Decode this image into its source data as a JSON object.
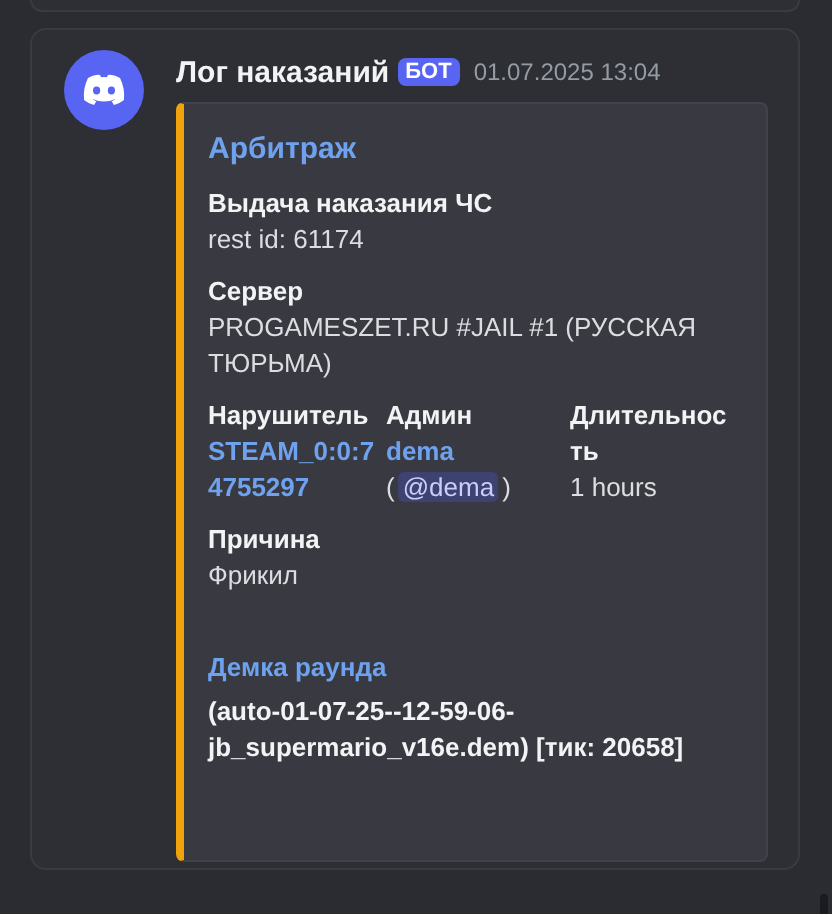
{
  "message": {
    "author": "Лог наказаний",
    "badge": "БОТ",
    "timestamp": "01.07.2025 13:04",
    "embed": {
      "color": "#f0a30a",
      "title": "Арбитраж",
      "fields": [
        {
          "kind": "plain",
          "inline": false,
          "name": "Выдача наказания ЧС",
          "value": [
            {
              "kind": "text",
              "text": "rest id: 61174"
            }
          ]
        },
        {
          "kind": "plain",
          "inline": false,
          "name": "Сервер",
          "value": [
            {
              "kind": "text",
              "text": "PROGAMESZET.RU #JAIL #1 (РУССКАЯ ТЮРЬМА)"
            }
          ]
        },
        {
          "kind": "plain",
          "inline": true,
          "name": "Нарушитель",
          "value": [
            {
              "kind": "link",
              "text": "STEAM_0:0:74755297"
            }
          ]
        },
        {
          "kind": "plain",
          "inline": true,
          "name": "Админ",
          "value": [
            {
              "kind": "link",
              "text": "dema"
            },
            {
              "kind": "text",
              "text": "("
            },
            {
              "kind": "mention",
              "text": "@dema"
            },
            {
              "kind": "text",
              "text": ")"
            }
          ]
        },
        {
          "kind": "plain",
          "inline": true,
          "name": "Длительность",
          "value": [
            {
              "kind": "text",
              "text": "1 hours"
            }
          ]
        },
        {
          "kind": "plain",
          "inline": false,
          "name": "Причина",
          "value": [
            {
              "kind": "text",
              "text": "Фрикил"
            }
          ]
        },
        {
          "kind": "highlight",
          "inline": false,
          "name": "Демка раунда",
          "value": [
            {
              "kind": "text",
              "text": "(auto-01-07-25--12-59-06-jb_supermario_v16e.dem) [тик: 20658]"
            }
          ]
        }
      ]
    }
  }
}
